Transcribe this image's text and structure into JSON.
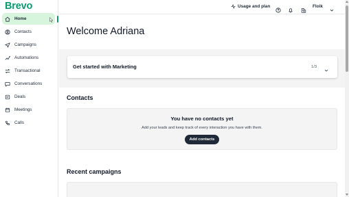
{
  "brand": {
    "logo_text": "Brevo",
    "accent_color": "#0b996e",
    "active_bg": "#d6f5dc"
  },
  "sidebar": {
    "items": [
      {
        "label": "Home",
        "icon": "home-icon",
        "active": true
      },
      {
        "label": "Contacts",
        "icon": "contacts-icon"
      },
      {
        "label": "Campaigns",
        "icon": "send-icon"
      },
      {
        "label": "Automations",
        "icon": "automation-icon"
      },
      {
        "label": "Transactional",
        "icon": "transactional-icon"
      },
      {
        "label": "Conversations",
        "icon": "chat-icon"
      },
      {
        "label": "Deals",
        "icon": "deals-icon"
      },
      {
        "label": "Meetings",
        "icon": "calendar-icon"
      },
      {
        "label": "Calls",
        "icon": "phone-icon"
      }
    ]
  },
  "topbar": {
    "usage_label": "Usage and plan",
    "account_name": "Floik"
  },
  "main": {
    "title": "Welcome Adriana",
    "marketing_card": {
      "title": "Get started with Marketing",
      "progress": "1/3"
    },
    "contacts": {
      "heading": "Contacts",
      "empty_title": "You have no contacts yet",
      "empty_text": "Add your leads and keep track of every interaction you have with them.",
      "add_button": "Add contacts"
    },
    "campaigns": {
      "heading": "Recent campaigns"
    }
  }
}
